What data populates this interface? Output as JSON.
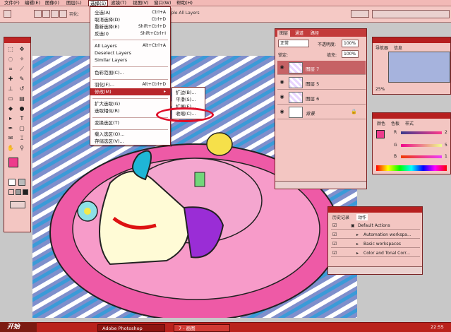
{
  "menubar": {
    "items": [
      "文件(F)",
      "编辑(E)",
      "图像(I)",
      "图层(L)",
      "选择(S)",
      "滤镜(T)",
      "视图(V)",
      "窗口(W)",
      "帮助(H)"
    ]
  },
  "options_bar": {
    "feather_label": "羽化:",
    "sample_label": "Sample All Layers"
  },
  "select_menu": {
    "items": [
      {
        "label": "全选(A)",
        "shortcut": "Ctrl+A"
      },
      {
        "label": "取消选择(D)",
        "shortcut": "Ctrl+D"
      },
      {
        "label": "重新选择(E)",
        "shortcut": "Shift+Ctrl+D"
      },
      {
        "label": "反选(I)",
        "shortcut": "Shift+Ctrl+I"
      },
      {
        "label": "All Layers",
        "shortcut": "Alt+Ctrl+A"
      },
      {
        "label": "Deselect Layers",
        "shortcut": ""
      },
      {
        "label": "Similar Layers",
        "shortcut": ""
      },
      {
        "label": "色彩范围(C)...",
        "shortcut": ""
      },
      {
        "label": "羽化(F)...",
        "shortcut": "Alt+Ctrl+D"
      },
      {
        "label": "修改(M)",
        "shortcut": "▸"
      },
      {
        "label": "扩大选取(G)",
        "shortcut": ""
      },
      {
        "label": "选取相似(R)",
        "shortcut": ""
      },
      {
        "label": "变换选区(T)",
        "shortcut": ""
      },
      {
        "label": "载入选区(O)...",
        "shortcut": ""
      },
      {
        "label": "存储选区(V)...",
        "shortcut": ""
      }
    ]
  },
  "modify_submenu": {
    "items": [
      "扩边(B)...",
      "平滑(S)...",
      "扩展(E)...",
      "收缩(C)..."
    ]
  },
  "layers_panel": {
    "tabs": [
      "图层",
      "通道",
      "路径"
    ],
    "blend_mode": "正常",
    "opacity_label": "不透明度:",
    "opacity_value": "100%",
    "lock_label": "锁定:",
    "fill_label": "填充:",
    "fill_value": "100%",
    "layers": [
      {
        "name": "图层 7",
        "selected": true
      },
      {
        "name": "图层 5",
        "selected": false
      },
      {
        "name": "图层 6",
        "selected": false
      },
      {
        "name": "背景",
        "selected": false
      }
    ]
  },
  "navigator": {
    "tabs": [
      "导航器",
      "信息"
    ],
    "zoom": "25%"
  },
  "color_panel": {
    "tabs": [
      "颜色",
      "色板",
      "样式"
    ],
    "channels": [
      {
        "label": "R",
        "value": "2"
      },
      {
        "label": "G",
        "value": "5"
      },
      {
        "label": "B",
        "value": "1"
      }
    ]
  },
  "history_panel": {
    "tabs": [
      "历史记录",
      "动作"
    ],
    "items": [
      "Default Actions",
      "Automation workspa...",
      "Basic workspaces",
      "Color and Tonal Corr..."
    ]
  },
  "taskbar": {
    "start_label": "开始",
    "tasks": [
      "Adobe Photoshop",
      "7 - 画图"
    ],
    "clock": "22:55"
  },
  "colors": {
    "accent": "#b8252a",
    "panel_bg": "#f3c6c2",
    "foreground_swatch": "#ee3b8c"
  }
}
